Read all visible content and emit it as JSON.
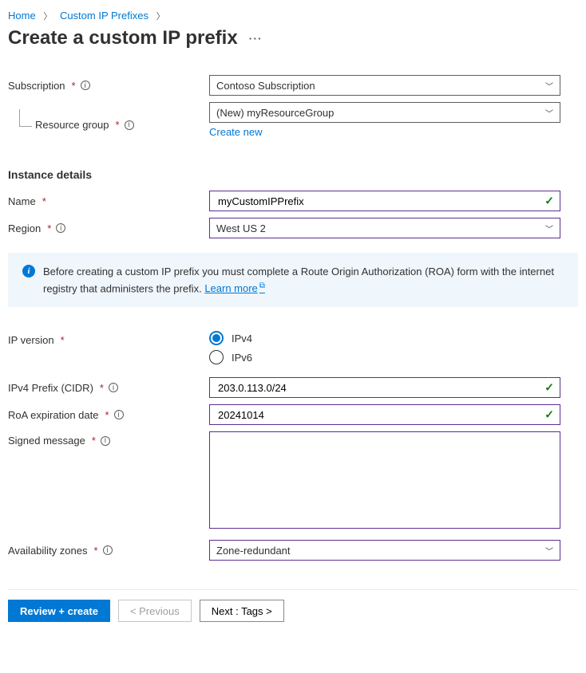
{
  "breadcrumb": {
    "home": "Home",
    "section": "Custom IP Prefixes"
  },
  "title": "Create a custom IP prefix",
  "labels": {
    "subscription": "Subscription",
    "resource_group": "Resource group",
    "create_new": "Create new",
    "instance_details": "Instance details",
    "name": "Name",
    "region": "Region",
    "ip_version": "IP version",
    "ipv4_prefix": "IPv4 Prefix (CIDR)",
    "roa_date": "RoA expiration date",
    "signed_message": "Signed message",
    "availability_zones": "Availability zones"
  },
  "values": {
    "subscription": "Contoso Subscription",
    "resource_group": "(New) myResourceGroup",
    "name": "myCustomIPPrefix",
    "region": "West US 2",
    "ipv4": "IPv4",
    "ipv6": "IPv6",
    "ipv4_prefix": "203.0.113.0/24",
    "roa_date": "20241014",
    "availability_zones": "Zone-redundant"
  },
  "infobox": {
    "text": "Before creating a custom IP prefix you must complete a Route Origin Authorization (ROA) form with the internet registry that administers the prefix. ",
    "learn_more": "Learn more"
  },
  "buttons": {
    "review": "Review + create",
    "previous": "< Previous",
    "next": "Next : Tags >"
  }
}
